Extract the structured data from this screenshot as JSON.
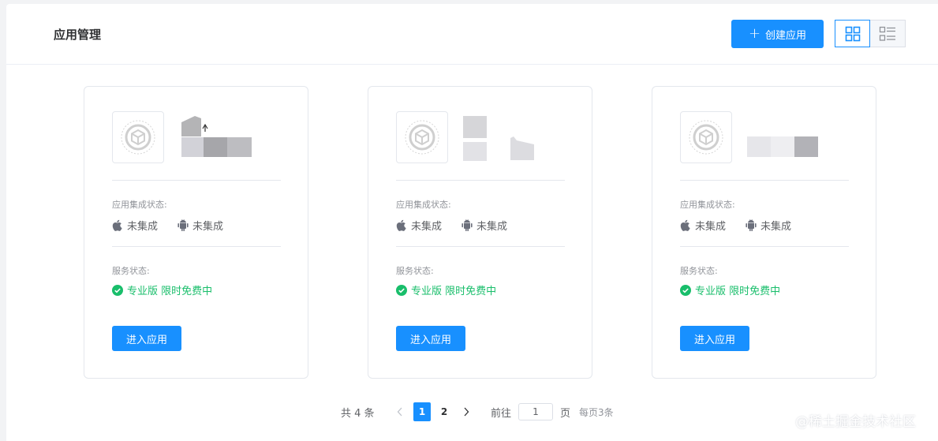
{
  "header": {
    "title": "应用管理",
    "create_label": "创建应用",
    "view_grid_icon": "grid-icon",
    "view_list_icon": "list-icon"
  },
  "cards": [
    {
      "integration_label": "应用集成状态:",
      "ios_status": "未集成",
      "android_status": "未集成",
      "service_label": "服务状态:",
      "service_status": "专业版 限时免费中",
      "enter_label": "进入应用"
    },
    {
      "integration_label": "应用集成状态:",
      "ios_status": "未集成",
      "android_status": "未集成",
      "service_label": "服务状态:",
      "service_status": "专业版 限时免费中",
      "enter_label": "进入应用"
    },
    {
      "integration_label": "应用集成状态:",
      "ios_status": "未集成",
      "android_status": "未集成",
      "service_label": "服务状态:",
      "service_status": "专业版 限时免费中",
      "enter_label": "进入应用"
    }
  ],
  "pagination": {
    "total": "共 4 条",
    "pages": [
      "1",
      "2"
    ],
    "current": "1",
    "goto_prefix": "前往",
    "goto_value": "1",
    "goto_suffix": "页",
    "page_size": "每页3条"
  },
  "watermark": "@稀土掘金技术社区",
  "colors": {
    "primary": "#1890ff",
    "success": "#19be6b",
    "border": "#e4e7ed",
    "muted": "#909399"
  }
}
